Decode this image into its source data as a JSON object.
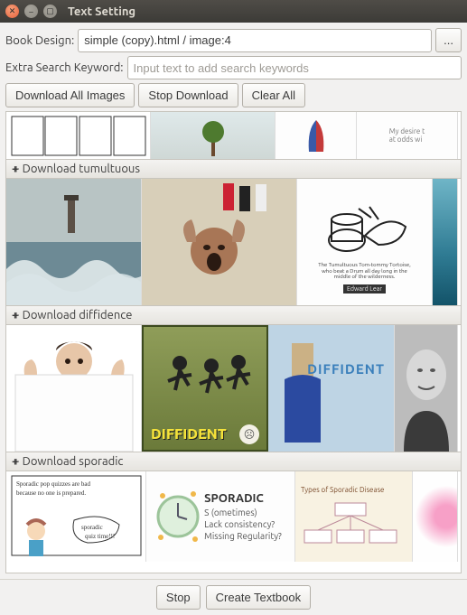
{
  "window": {
    "title": "Text Setting"
  },
  "form": {
    "book_design_label": "Book Design:",
    "book_design_value": "simple (copy).html / image:4",
    "browse_label": "...",
    "extra_keyword_label": "Extra Search Keyword:",
    "extra_keyword_placeholder": "Input text to add search keywords"
  },
  "toolbar": {
    "download_all": "Download All Images",
    "stop_download": "Stop Download",
    "clear_all": "Clear All"
  },
  "sections": [
    {
      "label": "+ Download tumultuous"
    },
    {
      "label": "+ Download diffidence"
    },
    {
      "label": "+ Download sporadic"
    }
  ],
  "thumbs": {
    "diffident_word": "DIFFIDENT",
    "diffident_word2": "DIFFIDENT",
    "sporadic_title": "SPORADIC",
    "sporadic_lines": "S (ometimes)\nLack consistency?\nMissing Regularity?",
    "sporadic_types": "Types of Sporadic Disease"
  },
  "footer": {
    "stop": "Stop",
    "create": "Create Textbook"
  }
}
